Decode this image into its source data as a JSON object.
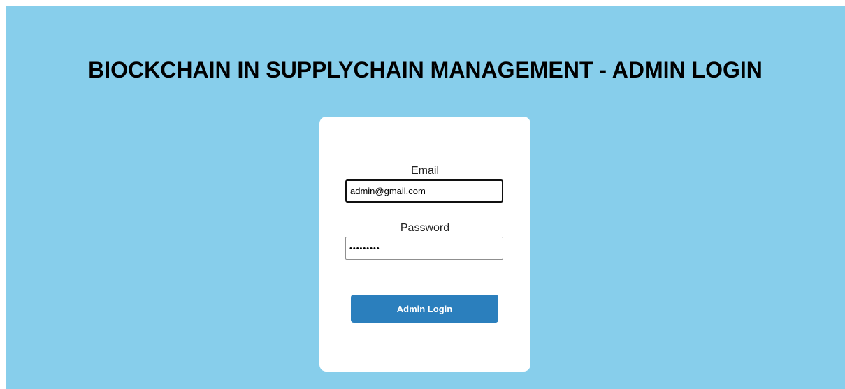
{
  "header": {
    "title": "BIOCKCHAIN IN SUPPLYCHAIN MANAGEMENT - ADMIN LOGIN"
  },
  "login_form": {
    "email_label": "Email",
    "email_value": "admin@gmail.com",
    "password_label": "Password",
    "password_value": "•••••••••",
    "submit_label": "Admin Login"
  },
  "colors": {
    "page_background": "#87ceeb",
    "card_background": "#ffffff",
    "button_background": "#2b7fbd",
    "button_text": "#ffffff"
  }
}
